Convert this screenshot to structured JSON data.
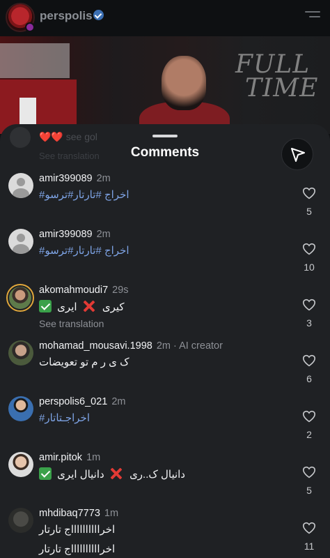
{
  "header": {
    "username": "perspolis",
    "avatar_icon": "perspolis-logo-icon",
    "menu_icon": "hamburger-menu-icon"
  },
  "post": {
    "overlay_text_line1": "FULL",
    "overlay_text_line2": "TIME"
  },
  "sheet": {
    "title": "Comments",
    "behind_caption_line1": "❤️❤️ see gol",
    "behind_caption_line2": "See translation",
    "send_icon": "send-icon"
  },
  "comments": [
    {
      "username": "amir399089",
      "time": "2m",
      "text": "#اخراج #تارتار#ترسو",
      "likes": "5"
    },
    {
      "username": "amir399089",
      "time": "2m",
      "text": "#اخراج #تارتار#ترسو",
      "likes": "10"
    },
    {
      "username": "akomahmoudi7",
      "time": "29s",
      "text_a": "ایری",
      "text_b": "کیری",
      "see_translation": "See translation",
      "likes": "3"
    },
    {
      "username": "mohamad_mousavi.1998",
      "time": "2m",
      "extra": "· AI creator",
      "text": "ک ی ر م تو تعویضات",
      "likes": "6"
    },
    {
      "username": "perspolis6_021",
      "time": "2m",
      "text": "#اخراجـتاتار",
      "likes": "2"
    },
    {
      "username": "amir.pitok",
      "time": "1m",
      "text_a": "دانیال ایری",
      "text_b": "دانیال ک..ری",
      "likes": "5"
    },
    {
      "username": "mhdibaq7773",
      "time": "1m",
      "text": "اخرااااااااااج تارتار",
      "text2": "اخرااااااااااج تارتار",
      "likes": "11"
    }
  ],
  "colors": {
    "hashtag": "#7ea4e6",
    "sheet_bg": "#1f2124",
    "muted": "#8d9096"
  }
}
